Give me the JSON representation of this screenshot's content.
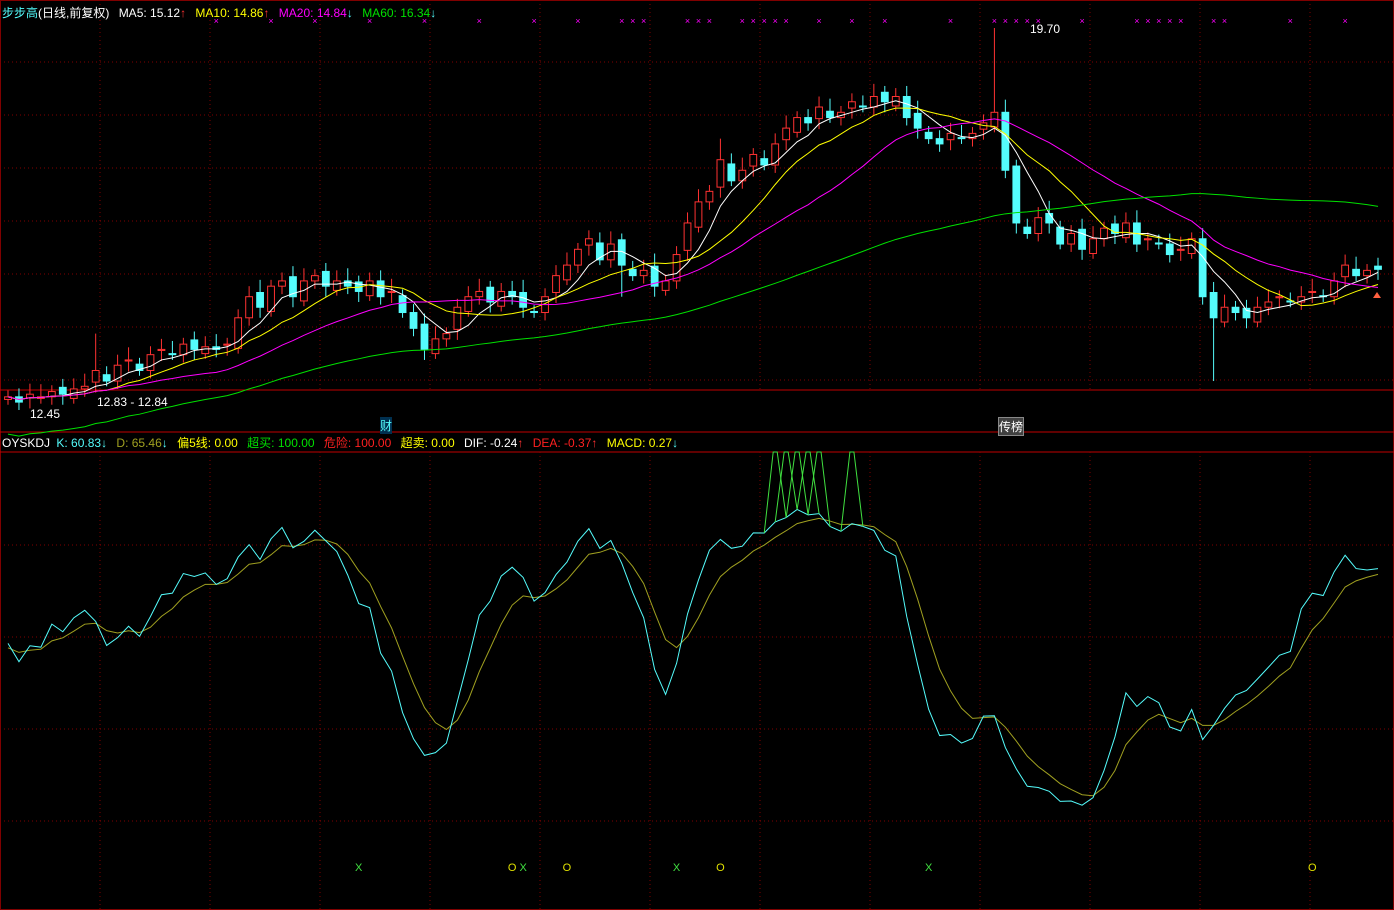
{
  "header": {
    "name": "步步高",
    "period": "(日线,前复权)",
    "ma5": "MA5: 15.12",
    "ma10": "MA10: 14.86",
    "ma20": "MA20: 14.84",
    "ma60": "MA60: 16.34",
    "ma5_dir": "↑",
    "ma10_dir": "↑",
    "ma20_dir": "↓",
    "ma60_dir": "↓"
  },
  "indicator": {
    "name": "OYSKDJ",
    "k": "K: 60.83",
    "k_dir": "↓",
    "d": "D: 65.46",
    "d_dir": "↓",
    "p5": "偏5线: 0.00",
    "overbuy": "超买: 100.00",
    "danger": "危险: 100.00",
    "oversell": "超卖: 0.00",
    "dif": "DIF: -0.24",
    "dif_dir": "↑",
    "dea": "DEA: -0.37",
    "dea_dir": "↑",
    "macd": "MACD: 0.27",
    "macd_dir": "↓"
  },
  "annotations": {
    "high": "19.70",
    "low": "12.45",
    "range": "12.83 - 12.84",
    "event1": "财",
    "event2": "传榜"
  },
  "colors": {
    "up": "#ff3232",
    "down": "#54fcfc",
    "ma5": "#ffffff",
    "ma10": "#ffff00",
    "ma20": "#ff00ff",
    "ma60": "#00e000",
    "k": "#54fcfc",
    "d": "#a0a020",
    "grid": "#800000"
  },
  "chart_data": {
    "type": "candlestick",
    "price_range": [
      12.45,
      19.7
    ],
    "close": [
      12.7,
      12.6,
      12.75,
      12.7,
      12.8,
      12.75,
      12.85,
      12.9,
      13.2,
      13.0,
      13.3,
      13.4,
      13.2,
      13.5,
      13.6,
      13.5,
      13.7,
      13.6,
      13.65,
      13.6,
      13.7,
      14.2,
      14.6,
      14.4,
      14.8,
      14.9,
      14.6,
      14.9,
      15.0,
      14.8,
      14.9,
      14.8,
      14.7,
      14.9,
      14.6,
      14.7,
      14.3,
      14.0,
      13.6,
      13.8,
      13.9,
      14.4,
      14.6,
      14.7,
      14.5,
      14.7,
      14.6,
      14.4,
      14.3,
      14.6,
      15.0,
      15.2,
      15.5,
      15.7,
      15.3,
      15.6,
      15.2,
      15.0,
      15.1,
      14.8,
      14.9,
      15.4,
      16.0,
      16.4,
      16.6,
      17.2,
      16.8,
      17.0,
      17.3,
      17.1,
      17.5,
      17.8,
      18.0,
      17.9,
      18.2,
      18.0,
      18.1,
      18.3,
      18.2,
      18.4,
      18.3,
      18.4,
      18.0,
      17.8,
      17.6,
      17.5,
      17.7,
      17.6,
      17.7,
      17.9,
      18.1,
      17.0,
      16.0,
      15.8,
      16.1,
      16.0,
      15.6,
      15.8,
      15.5,
      15.7,
      15.9,
      15.8,
      16.0,
      15.6,
      15.7,
      15.6,
      15.4,
      15.5,
      15.7,
      14.6,
      14.2,
      14.4,
      14.3,
      14.2,
      14.4,
      14.5,
      14.6,
      14.5,
      14.6,
      14.7,
      14.6,
      14.9,
      15.2,
      15.0,
      15.1,
      15.12
    ],
    "high_overrides": {
      "90": 19.7,
      "8": 13.9,
      "65": 17.6,
      "109": 15.9
    },
    "low_overrides": {
      "110": 13.0,
      "1": 12.45,
      "56": 14.6
    },
    "top_markers": [
      19,
      24,
      28,
      33,
      38,
      43,
      48,
      52,
      56,
      57,
      58,
      62,
      63,
      64,
      67,
      68,
      69,
      70,
      71,
      74,
      77,
      80,
      86,
      90,
      91,
      92,
      93,
      94,
      98,
      103,
      104,
      105,
      106,
      107,
      110,
      111,
      117,
      122
    ],
    "signals": [
      {
        "bar": 32,
        "label": "X"
      },
      {
        "bar": 46,
        "label": "O"
      },
      {
        "bar": 47,
        "label": "X"
      },
      {
        "bar": 51,
        "label": "O"
      },
      {
        "bar": 61,
        "label": "X"
      },
      {
        "bar": 65,
        "label": "O"
      },
      {
        "bar": 84,
        "label": "X"
      },
      {
        "bar": 119,
        "label": "O"
      }
    ],
    "kdj_range": [
      0,
      100
    ]
  }
}
